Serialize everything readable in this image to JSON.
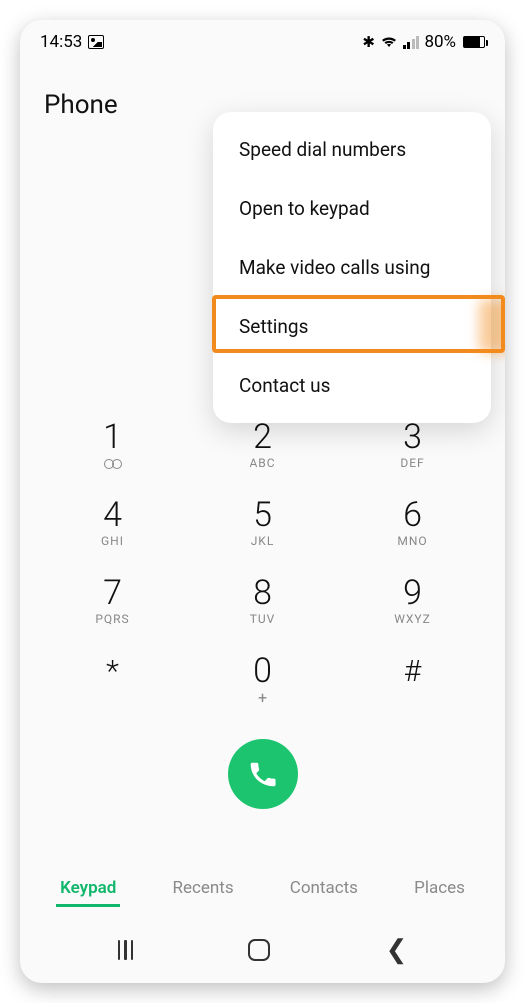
{
  "status": {
    "time": "14:53",
    "battery_pct": "80%"
  },
  "header": {
    "title": "Phone"
  },
  "menu": {
    "items": [
      "Speed dial numbers",
      "Open to keypad",
      "Make video calls using",
      "Settings",
      "Contact us"
    ],
    "highlighted_index": 3
  },
  "keypad": {
    "keys": [
      {
        "digit": "1",
        "sub_icon": "voicemail"
      },
      {
        "digit": "2",
        "sub": "ABC"
      },
      {
        "digit": "3",
        "sub": "DEF"
      },
      {
        "digit": "4",
        "sub": "GHI"
      },
      {
        "digit": "5",
        "sub": "JKL"
      },
      {
        "digit": "6",
        "sub": "MNO"
      },
      {
        "digit": "7",
        "sub": "PQRS"
      },
      {
        "digit": "8",
        "sub": "TUV"
      },
      {
        "digit": "9",
        "sub": "WXYZ"
      },
      {
        "digit": "*"
      },
      {
        "digit": "0",
        "sub": "+"
      },
      {
        "digit": "#"
      }
    ]
  },
  "tabs": {
    "items": [
      "Keypad",
      "Recents",
      "Contacts",
      "Places"
    ],
    "active": 0
  }
}
